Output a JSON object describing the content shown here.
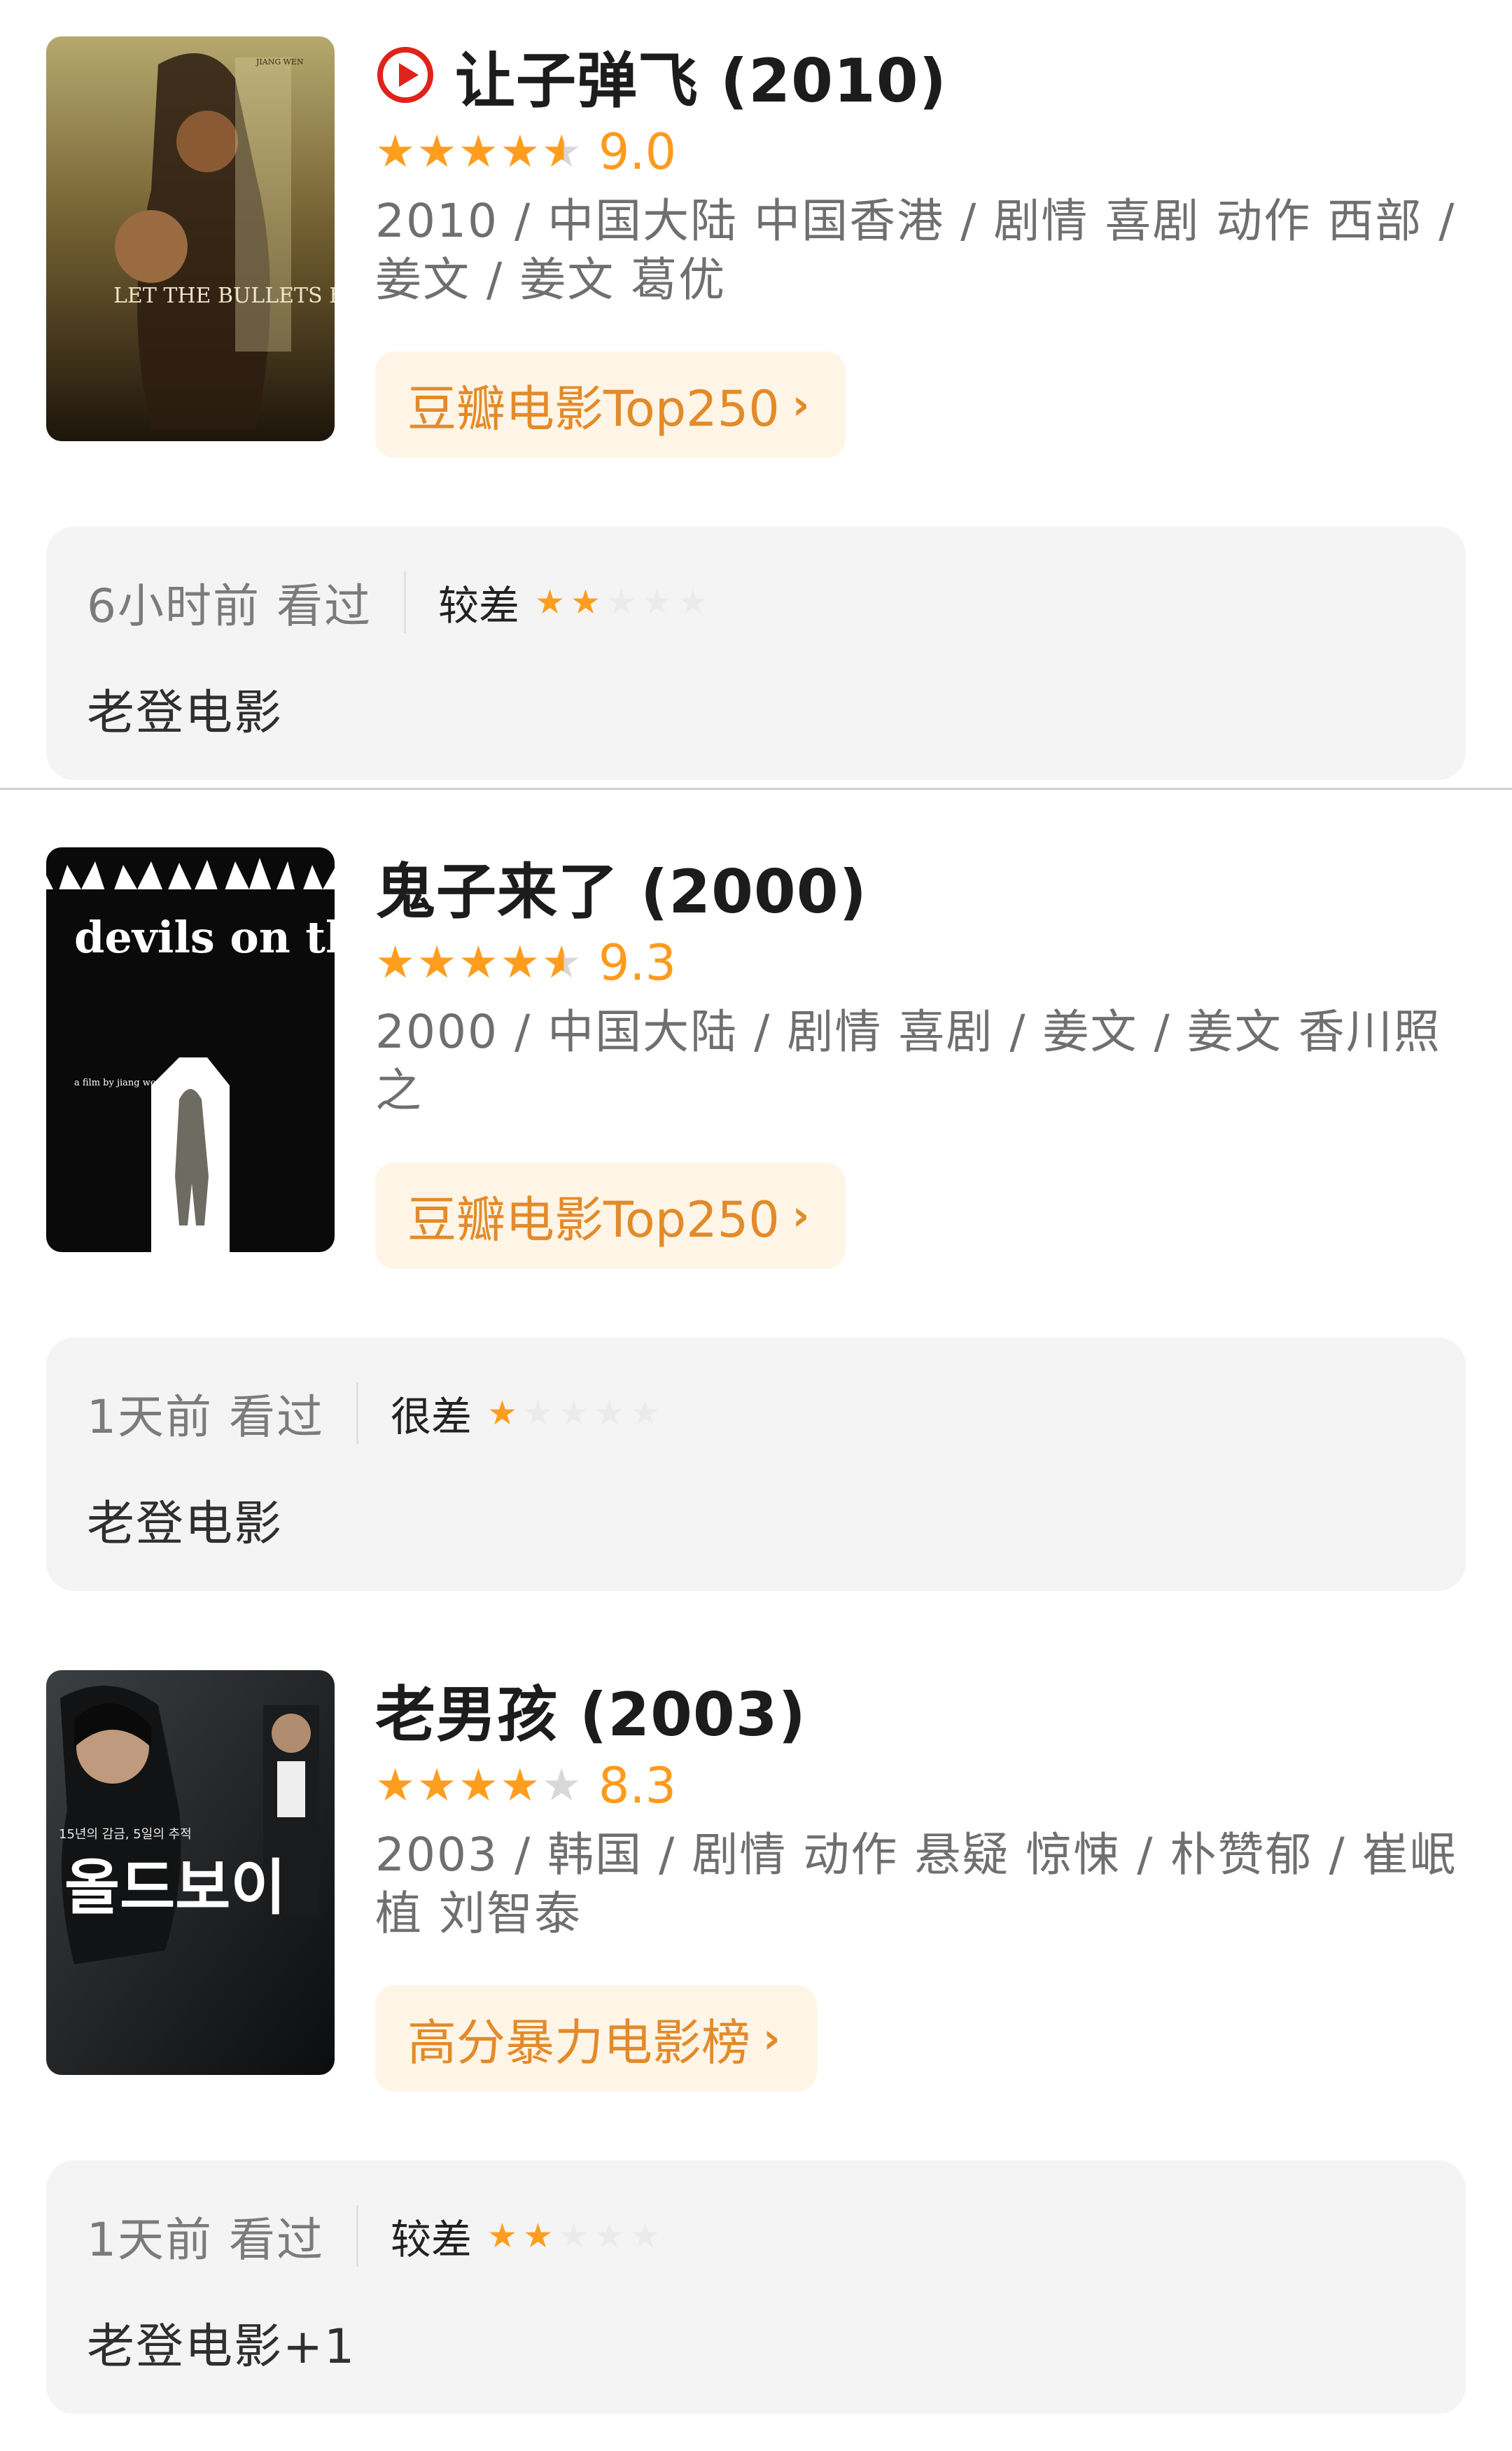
{
  "movies": [
    {
      "title": "让子弹飞 (2010)",
      "score": "9.0",
      "stars": 4.5,
      "meta": "2010 / 中国大陆 中国香港 / 剧情 喜剧 动作 西部 / 姜文 / 姜文 葛优",
      "chart_label": "豆瓣电影Top250",
      "has_play_icon": true,
      "poster_text": "LET THE BULLETS FLY",
      "poster_top": "JIANG WEN",
      "watched": "6小时前  看过",
      "my_label": "较差",
      "my_stars": 2,
      "note": "老登电影"
    },
    {
      "title": "鬼子来了 (2000)",
      "score": "9.3",
      "stars": 4.5,
      "meta": "2000 / 中国大陆 / 剧情 喜剧 / 姜文 / 姜文 香川照之",
      "chart_label": "豆瓣电影Top250",
      "has_play_icon": false,
      "poster_text": "devils on the door step",
      "poster_top": "a film by jiang wen",
      "watched": "1天前  看过",
      "my_label": "很差",
      "my_stars": 1,
      "note": "老登电影"
    },
    {
      "title": "老男孩 (2003)",
      "score": "8.3",
      "stars": 4,
      "meta": "2003 / 韩国 / 剧情 动作 悬疑 惊悚 / 朴赞郁 / 崔岷植 刘智泰",
      "chart_label": "高分暴力电影榜",
      "has_play_icon": false,
      "poster_text": "올드보이",
      "poster_top": "15년의 감금, 5일의 추적",
      "watched": "1天前  看过",
      "my_label": "较差",
      "my_stars": 2,
      "note": "老登电影+1"
    }
  ],
  "colors": {
    "accent": "#ff9d1f",
    "chip_bg": "#fff5e6",
    "chip_text": "#e38a2a",
    "card_bg": "#f4f4f4",
    "play_red": "#e0231a"
  },
  "icons": {
    "play": "play-circle-icon",
    "chevron": "chevron-right-icon",
    "star": "star-icon"
  }
}
